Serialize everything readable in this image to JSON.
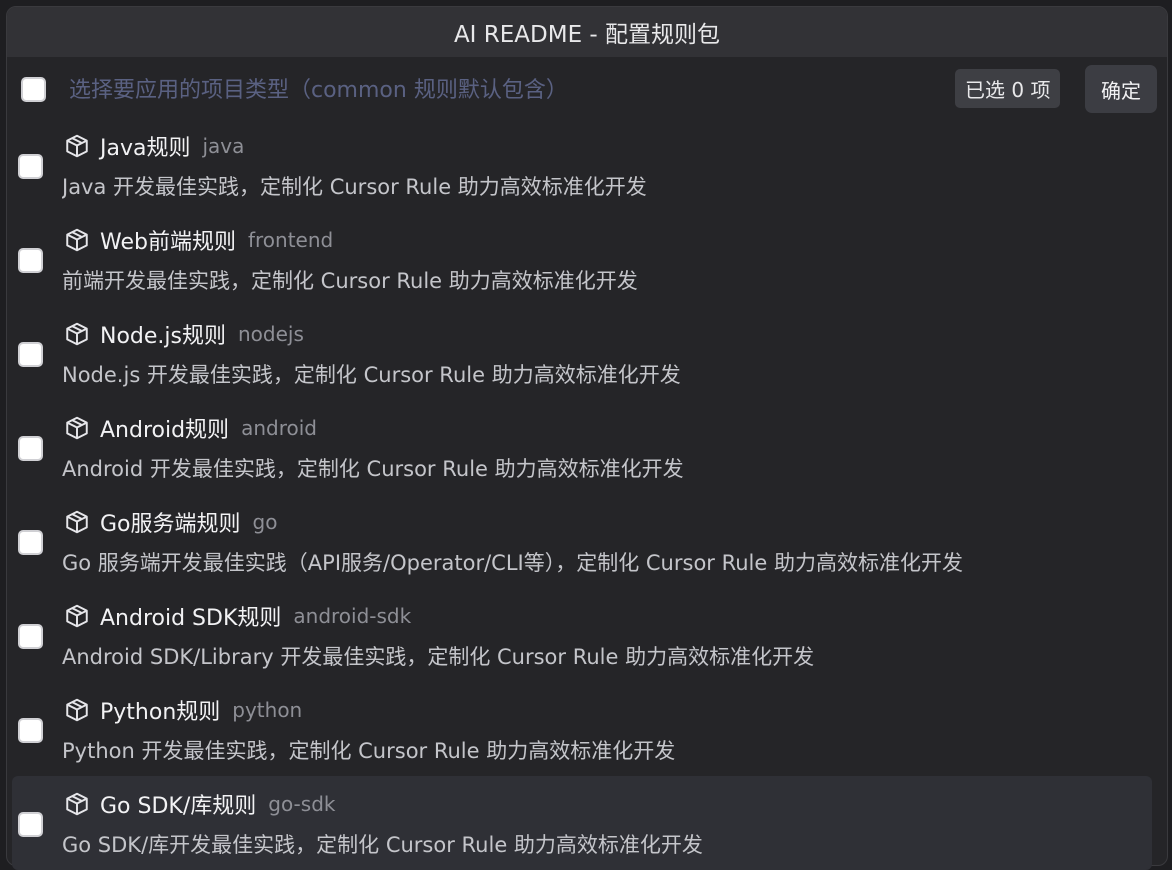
{
  "window": {
    "title": "AI README - 配置规则包"
  },
  "header": {
    "placeholder": "选择要应用的项目类型（common 规则默认包含）",
    "selected_count": "已选 0 项",
    "confirm_label": "确定"
  },
  "items": [
    {
      "name": "Java规则",
      "id": "java",
      "desc": "Java 开发最佳实践，定制化 Cursor Rule 助力高效标准化开发"
    },
    {
      "name": "Web前端规则",
      "id": "frontend",
      "desc": "前端开发最佳实践，定制化 Cursor Rule 助力高效标准化开发"
    },
    {
      "name": "Node.js规则",
      "id": "nodejs",
      "desc": "Node.js 开发最佳实践，定制化 Cursor Rule 助力高效标准化开发"
    },
    {
      "name": "Android规则",
      "id": "android",
      "desc": "Android 开发最佳实践，定制化 Cursor Rule 助力高效标准化开发"
    },
    {
      "name": "Go服务端规则",
      "id": "go",
      "desc": "Go 服务端开发最佳实践（API服务/Operator/CLI等），定制化 Cursor Rule 助力高效标准化开发"
    },
    {
      "name": "Android SDK规则",
      "id": "android-sdk",
      "desc": "Android SDK/Library 开发最佳实践，定制化 Cursor Rule 助力高效标准化开发"
    },
    {
      "name": "Python规则",
      "id": "python",
      "desc": "Python 开发最佳实践，定制化 Cursor Rule 助力高效标准化开发"
    },
    {
      "name": "Go SDK/库规则",
      "id": "go-sdk",
      "desc": "Go SDK/库开发最佳实践，定制化 Cursor Rule 助力高效标准化开发"
    }
  ],
  "icons": {
    "item_icon": "package-icon"
  }
}
